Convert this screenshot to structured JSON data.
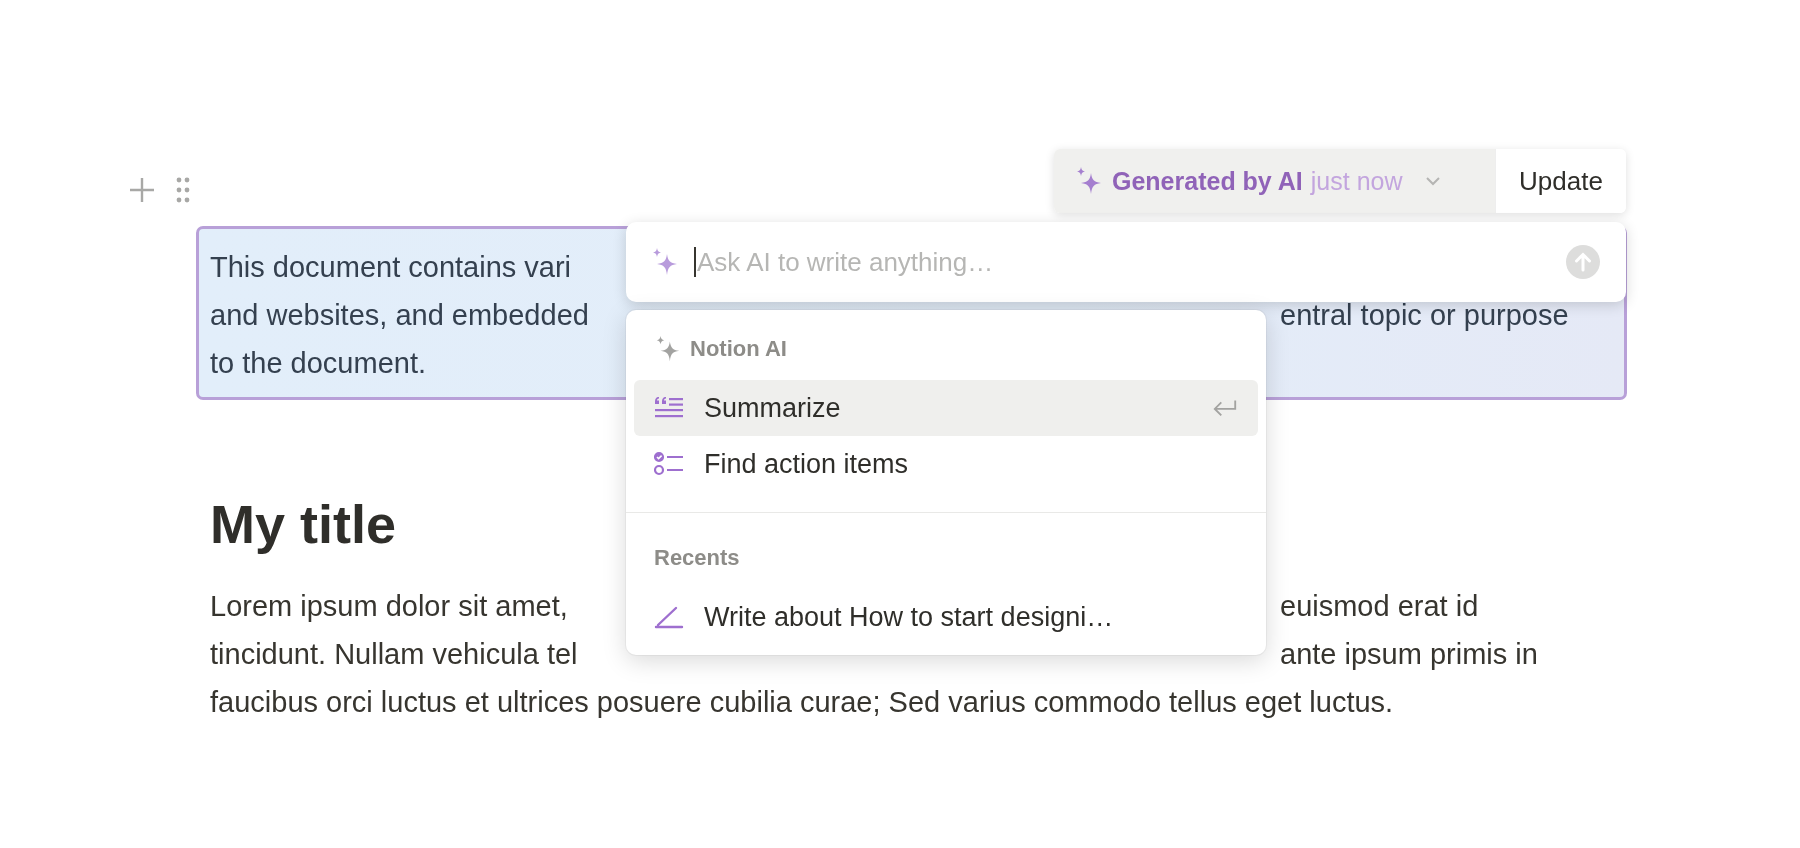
{
  "ai_block": {
    "lines": [
      {
        "left": "This document contains vari"
      },
      {
        "left": "and websites, and embedded",
        "right": "entral topic or purpose"
      },
      {
        "left": "to the document."
      }
    ]
  },
  "ai_badge": {
    "label": "Generated by AI",
    "time": "just now",
    "button": "Update"
  },
  "ai_prompt": {
    "placeholder": "Ask AI to write anything…"
  },
  "ai_menu": {
    "sections": [
      {
        "title": "Notion AI",
        "kind": "ai",
        "items": [
          {
            "label": "Summarize",
            "kind": "summarize",
            "selected": true
          },
          {
            "label": "Find action items",
            "kind": "action-items",
            "selected": false
          }
        ]
      },
      {
        "title": "Recents",
        "kind": "recents",
        "items": [
          {
            "label": "Write about How to start designi…",
            "kind": "write",
            "selected": false
          }
        ]
      }
    ]
  },
  "heading": "My title",
  "paragraph": {
    "lines": [
      {
        "left": "Lorem ipsum dolor sit amet,",
        "right": "euismod erat id"
      },
      {
        "left": "tincidunt. Nullam vehicula tel",
        "right": "ante ipsum primis in"
      },
      {
        "left": "faucibus orci luctus et ultrices posuere cubilia curae; Sed varius commodo tellus eget luctus."
      }
    ]
  }
}
